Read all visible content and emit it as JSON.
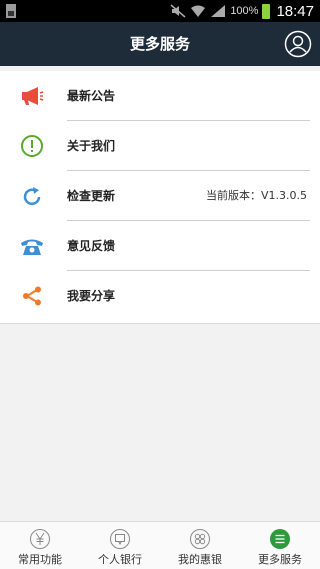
{
  "status_bar": {
    "battery": "100%",
    "time": "18:47"
  },
  "header": {
    "title": "更多服务"
  },
  "menu": [
    {
      "label": "最新公告",
      "icon": "megaphone-icon",
      "color": "#e84c3d"
    },
    {
      "label": "关于我们",
      "icon": "info-exclamation-icon",
      "color": "#5aa82e"
    },
    {
      "label": "检查更新",
      "icon": "refresh-icon",
      "color": "#3d8fd6",
      "value": "当前版本：V1.3.0.5"
    },
    {
      "label": "意见反馈",
      "icon": "phone-icon",
      "color": "#3d8fd6"
    },
    {
      "label": "我要分享",
      "icon": "share-icon",
      "color": "#ee7b2c"
    }
  ],
  "bottom_nav": [
    {
      "label": "常用功能",
      "icon": "yen-icon",
      "active": false
    },
    {
      "label": "个人银行",
      "icon": "chat-icon",
      "active": false
    },
    {
      "label": "我的惠银",
      "icon": "grid-icon",
      "active": false
    },
    {
      "label": "更多服务",
      "icon": "menu-list-icon",
      "active": true
    }
  ],
  "colors": {
    "header_bg": "#1e2b38",
    "active_green": "#2d9a3b"
  }
}
